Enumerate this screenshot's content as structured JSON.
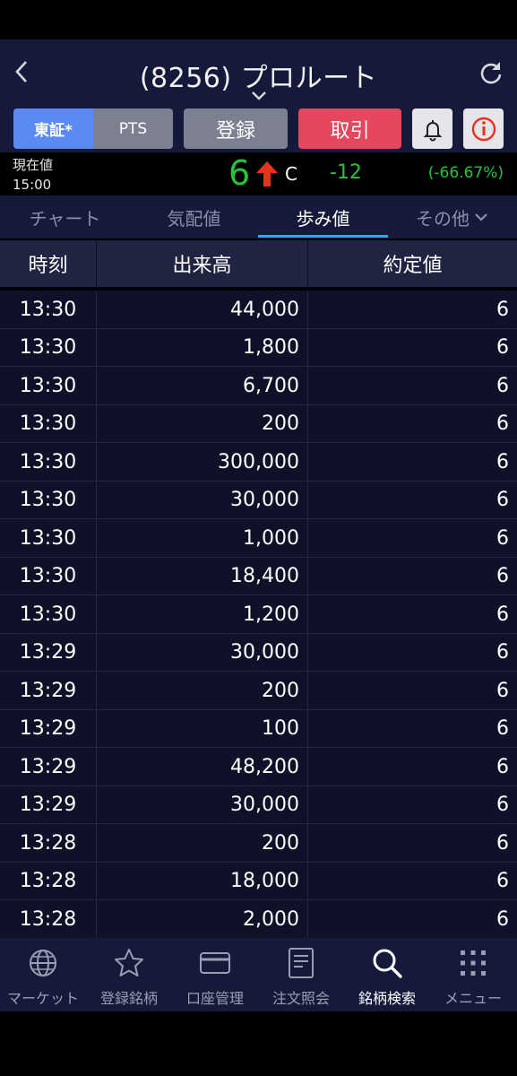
{
  "header": {
    "title": "(8256) プロルート"
  },
  "buttons": {
    "market_tse": "東証*",
    "market_pts": "PTS",
    "register": "登録",
    "trade": "取引"
  },
  "price": {
    "label": "現在値",
    "time": "15:00",
    "value": "6",
    "flag": "C",
    "change": "-12",
    "change_pct": "(-66.67%)",
    "color_up": "#29c23a",
    "arrow_color": "#e8321e"
  },
  "tabs": [
    {
      "label": "チャート"
    },
    {
      "label": "気配値"
    },
    {
      "label": "歩み値",
      "active": true
    },
    {
      "label": "その他"
    }
  ],
  "table": {
    "headers": [
      "時刻",
      "出来高",
      "約定値"
    ],
    "rows": [
      [
        "13:30",
        "44,000",
        "6"
      ],
      [
        "13:30",
        "1,800",
        "6"
      ],
      [
        "13:30",
        "6,700",
        "6"
      ],
      [
        "13:30",
        "200",
        "6"
      ],
      [
        "13:30",
        "300,000",
        "6"
      ],
      [
        "13:30",
        "30,000",
        "6"
      ],
      [
        "13:30",
        "1,000",
        "6"
      ],
      [
        "13:30",
        "18,400",
        "6"
      ],
      [
        "13:30",
        "1,200",
        "6"
      ],
      [
        "13:29",
        "30,000",
        "6"
      ],
      [
        "13:29",
        "200",
        "6"
      ],
      [
        "13:29",
        "100",
        "6"
      ],
      [
        "13:29",
        "48,200",
        "6"
      ],
      [
        "13:29",
        "30,000",
        "6"
      ],
      [
        "13:28",
        "200",
        "6"
      ],
      [
        "13:28",
        "18,000",
        "6"
      ],
      [
        "13:28",
        "2,000",
        "6"
      ]
    ]
  },
  "nav": [
    {
      "label": "マーケット",
      "icon": "globe-icon"
    },
    {
      "label": "登録銘柄",
      "icon": "star-icon"
    },
    {
      "label": "口座管理",
      "icon": "card-icon"
    },
    {
      "label": "注文照会",
      "icon": "document-icon"
    },
    {
      "label": "銘柄検索",
      "icon": "search-icon",
      "active": true
    },
    {
      "label": "メニュー",
      "icon": "grid-menu-icon"
    }
  ],
  "colors": {
    "header_bg": "#161a3a",
    "accent_blue": "#5b8af2",
    "trade_red": "#e5485e",
    "tab_underline": "#35a3e8"
  }
}
